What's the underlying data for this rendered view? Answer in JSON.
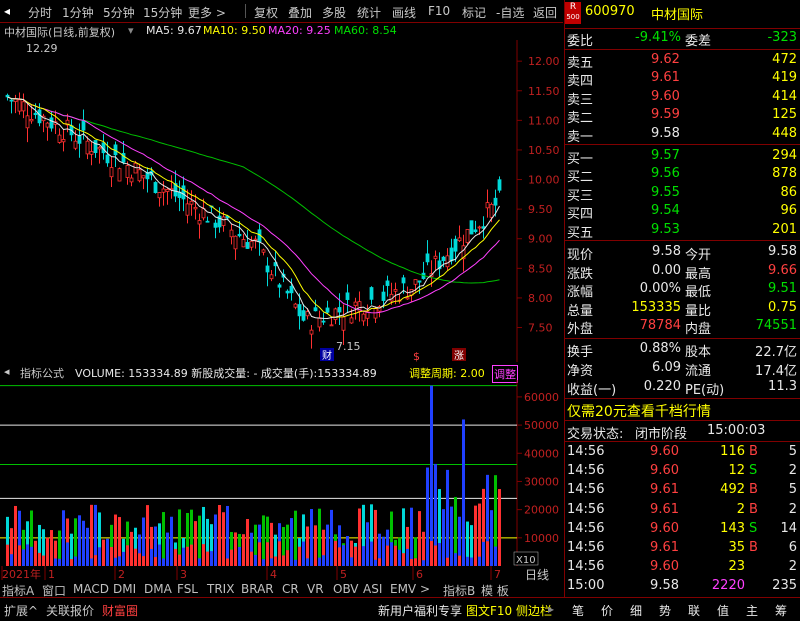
{
  "toolbar": {
    "items": [
      "分时",
      "1分钟",
      "5分钟",
      "15分钟",
      "更多 >",
      "复权",
      "叠加",
      "多股",
      "统计",
      "画线",
      "F10",
      "标记",
      "-自选",
      "返回"
    ]
  },
  "chart_header": {
    "stock_label": "中材国际(日线,前复权)",
    "ma5": "MA5: 9.67",
    "ma10": "MA10: 9.50",
    "ma20": "MA20: 9.25",
    "ma60": "MA60: 8.54",
    "high_marker": "12.29",
    "low_marker": "7.15",
    "low_badge": "财",
    "badge_s": "$",
    "badge_zhang": "涨"
  },
  "colors": {
    "ma5": "#ffff00",
    "ma10": "#ff40ff",
    "ma20": "#00e000",
    "ma60": "#40ff40",
    "up": "#ff3030",
    "down": "#00d8d8"
  },
  "price_axis": [
    "12.00",
    "11.50",
    "11.00",
    "10.50",
    "10.00",
    "9.50",
    "9.00",
    "8.50",
    "8.00",
    "7.50"
  ],
  "volume_header": {
    "prefix": "指标公式",
    "text": "VOLUME: 153334.89 新股成交量: - 成交量(手):153334.89",
    "period": "调整周期: 2.00",
    "tag": "调整"
  },
  "volume_axis": [
    "60000",
    "50000",
    "40000",
    "30000",
    "20000",
    "10000"
  ],
  "volume_unit": "X10",
  "tabs": [
    "指标A",
    "窗口",
    "MACD",
    "DMI",
    "DMA",
    "FSL",
    "TRIX",
    "BRAR",
    "CR",
    "VR",
    "OBV",
    "ASI",
    "EMV",
    ">",
    "指标B",
    "模 板"
  ],
  "date_axis": [
    "2021年",
    "1",
    "2",
    "3",
    "4",
    "5",
    "6",
    "7"
  ],
  "period_label": "日线",
  "quote": {
    "code": "600970",
    "name": "中材国际",
    "r_badge": "R",
    "r_sub": "500",
    "webi_label": "委比",
    "webi_value": "-9.41%",
    "weicha_label": "委差",
    "weicha_value": "-323",
    "asks": [
      {
        "label": "卖五",
        "price": "9.62",
        "vol": "472"
      },
      {
        "label": "卖四",
        "price": "9.61",
        "vol": "419"
      },
      {
        "label": "卖三",
        "price": "9.60",
        "vol": "414"
      },
      {
        "label": "卖二",
        "price": "9.59",
        "vol": "125"
      },
      {
        "label": "卖一",
        "price": "9.58",
        "vol": "448"
      }
    ],
    "bids": [
      {
        "label": "买一",
        "price": "9.57",
        "vol": "294"
      },
      {
        "label": "买二",
        "price": "9.56",
        "vol": "878"
      },
      {
        "label": "买三",
        "price": "9.55",
        "vol": "86"
      },
      {
        "label": "买四",
        "price": "9.54",
        "vol": "96"
      },
      {
        "label": "买五",
        "price": "9.53",
        "vol": "201"
      }
    ],
    "stats": [
      {
        "l1": "现价",
        "v1": "9.58",
        "l2": "今开",
        "v2": "9.58",
        "c1": "wht",
        "c2": "wht"
      },
      {
        "l1": "涨跌",
        "v1": "0.00",
        "l2": "最高",
        "v2": "9.66",
        "c1": "wht",
        "c2": "red"
      },
      {
        "l1": "涨幅",
        "v1": "0.00%",
        "l2": "最低",
        "v2": "9.51",
        "c1": "wht",
        "c2": "grn"
      },
      {
        "l1": "总量",
        "v1": "153335",
        "l2": "量比",
        "v2": "0.75",
        "c1": "yel",
        "c2": "yel"
      },
      {
        "l1": "外盘",
        "v1": "78784",
        "l2": "内盘",
        "v2": "74551",
        "c1": "red",
        "c2": "grn"
      }
    ],
    "stats2": [
      {
        "l1": "换手",
        "v1": "0.88%",
        "l2": "股本",
        "v2": "22.7亿"
      },
      {
        "l1": "净资",
        "v1": "6.09",
        "l2": "流通",
        "v2": "17.4亿"
      },
      {
        "l1": "收益(一)",
        "v1": "0.220",
        "l2": "PE(动)",
        "v2": "11.3"
      }
    ],
    "promo": "仅需20元查看千档行情",
    "status_label": "交易状态:",
    "status_value": "闭市阶段",
    "status_time": "15:00:03",
    "ticks": [
      {
        "time": "14:56",
        "price": "9.60",
        "vol": "116",
        "side": "B",
        "n": "5"
      },
      {
        "time": "14:56",
        "price": "9.60",
        "vol": "12",
        "side": "S",
        "n": "2"
      },
      {
        "time": "14:56",
        "price": "9.61",
        "vol": "492",
        "side": "B",
        "n": "5"
      },
      {
        "time": "14:56",
        "price": "9.61",
        "vol": "2",
        "side": "B",
        "n": "2"
      },
      {
        "time": "14:56",
        "price": "9.60",
        "vol": "143",
        "side": "S",
        "n": "14"
      },
      {
        "time": "14:56",
        "price": "9.61",
        "vol": "35",
        "side": "B",
        "n": "6"
      },
      {
        "time": "14:56",
        "price": "9.60",
        "vol": "23",
        "side": "",
        "n": "2"
      },
      {
        "time": "15:00",
        "price": "9.58",
        "vol": "2220",
        "side": "",
        "n": "235"
      }
    ]
  },
  "bottom": {
    "left": [
      "扩展^",
      "关联报价",
      "财富圈"
    ],
    "promo": "新用户福利专享",
    "tuwen": "图文F10",
    "sidebar": "侧边栏",
    "right_icons": [
      "笔",
      "价",
      "细",
      "势",
      "联",
      "值",
      "主",
      "筹"
    ]
  }
}
